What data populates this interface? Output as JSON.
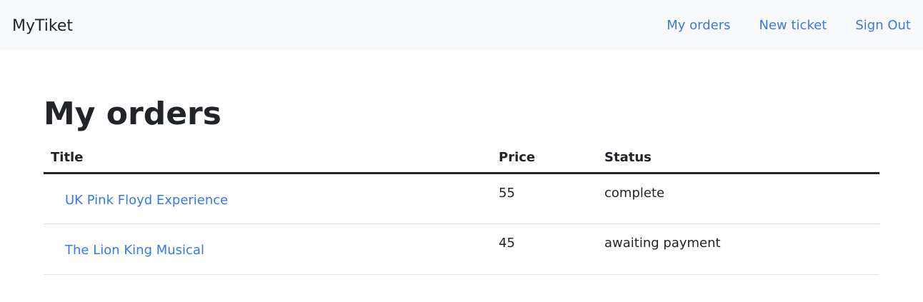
{
  "navbar": {
    "brand": "MyTiket",
    "links": [
      {
        "label": "My orders"
      },
      {
        "label": "New ticket"
      },
      {
        "label": "Sign Out"
      }
    ]
  },
  "page": {
    "title": "My orders"
  },
  "table": {
    "headers": [
      "Title",
      "Price",
      "Status"
    ],
    "rows": [
      {
        "title": "UK Pink Floyd Experience",
        "price": "55",
        "status": "complete"
      },
      {
        "title": "The Lion King Musical",
        "price": "45",
        "status": "awaiting payment"
      }
    ]
  },
  "colors": {
    "link": "#3a78e4",
    "navbar_bg": "#f8f9fa",
    "text": "#212529"
  }
}
